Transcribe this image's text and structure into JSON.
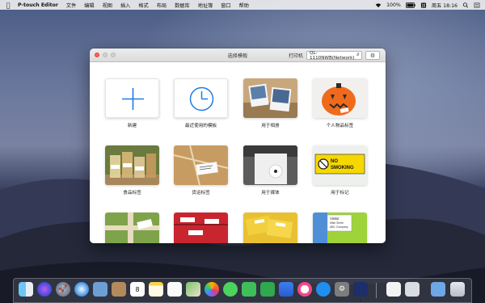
{
  "menubar": {
    "app_name": "P-touch Editor",
    "menus": [
      "文件",
      "编辑",
      "视图",
      "插入",
      "格式",
      "布局",
      "数据库",
      "地址簿",
      "窗口",
      "帮助"
    ],
    "battery": "100%",
    "datetime": "周五 18:16"
  },
  "window": {
    "title": "选择模板",
    "printer_label": "打印机",
    "printer_value": "QL-1110NWB(Network)"
  },
  "templates": [
    {
      "label": "新建",
      "icon": "plus-icon"
    },
    {
      "label": "最近使用的模板",
      "icon": "clock-icon"
    },
    {
      "label": "用于相册",
      "icon": "photo-album-image"
    },
    {
      "label": "个人物品标签",
      "icon": "pumpkin-image"
    },
    {
      "label": "食品标签",
      "icon": "food-jars-image"
    },
    {
      "label": "货运标签",
      "icon": "parcel-image"
    },
    {
      "label": "用于媒体",
      "icon": "media-disc-image"
    },
    {
      "label": "用于标记",
      "icon": "sign-image"
    },
    {
      "label": "",
      "icon": "gift-image"
    },
    {
      "label": "",
      "icon": "red-boxes-image"
    },
    {
      "label": "",
      "icon": "yellow-folders-image"
    },
    {
      "label": "",
      "icon": "name-badge-image"
    }
  ],
  "sign_text": [
    "NO",
    "SMOKING"
  ],
  "badge_text": [
    "Visitor",
    "Mike Smith",
    "ABC Company"
  ],
  "dock": {
    "apps": [
      "finder-icon",
      "siri-icon",
      "launchpad-icon",
      "safari-icon",
      "mail-stamp-icon",
      "contacts-icon",
      "calendar-icon",
      "notes-icon",
      "reminders-icon",
      "maps-icon",
      "photos-icon",
      "messages-icon",
      "facetime-icon",
      "numbers-icon",
      "keynote-icon",
      "itunes-icon",
      "app-store-icon",
      "system-preferences-icon",
      "ptouch-editor-icon",
      "document-icon",
      "preview-icon",
      "downloads-folder-icon",
      "trash-icon"
    ],
    "calendar_day": "8"
  },
  "colors": {
    "accent_blue": "#1d7ce6",
    "close_red": "#fc5f57",
    "window_bg": "#ffffff"
  }
}
